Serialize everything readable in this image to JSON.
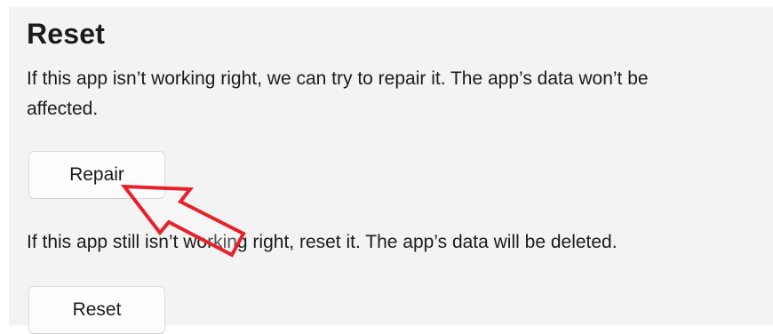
{
  "reset_section": {
    "title": "Reset",
    "repair_description": "If this app isn’t working right, we can try to repair it. The app’s data won’t be affected.",
    "repair_button_label": "Repair",
    "reset_description": "If this app still isn’t working right, reset it. The app’s data will be deleted.",
    "reset_button_label": "Reset"
  },
  "annotation": {
    "arrow_color": "#e8202a",
    "target": "repair-button"
  }
}
